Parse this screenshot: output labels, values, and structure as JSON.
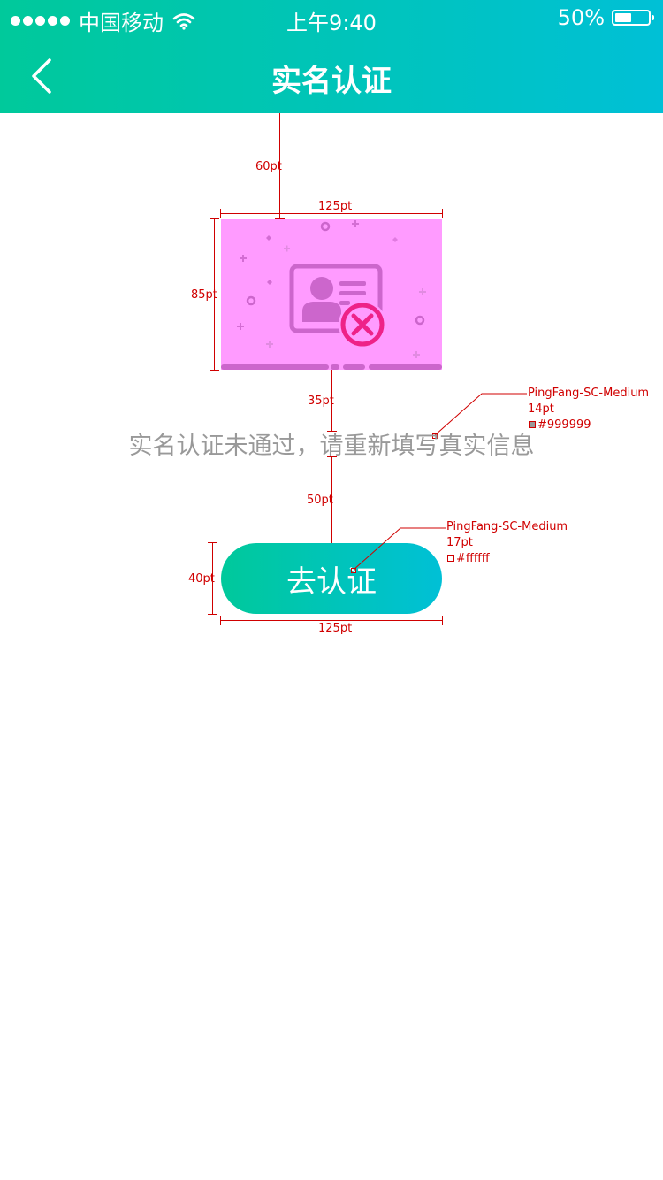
{
  "status_bar": {
    "carrier": "中国移动",
    "time": "上午9:40",
    "battery_text": "50%",
    "battery_level": 0.5
  },
  "nav": {
    "title": "实名认证",
    "back_icon": "chevron-left-icon"
  },
  "content": {
    "message": "实名认证未通过，请重新填写真实信息",
    "button_label": "去认证",
    "illustration_icon": "id-card-error-icon"
  },
  "annotations": {
    "top_spacing": "60pt",
    "image_width": "125pt",
    "image_height": "85pt",
    "image_to_text": "35pt",
    "text_font": "PingFang-SC-Medium",
    "text_size": "14pt",
    "text_color": "#999999",
    "text_to_button": "50pt",
    "button_font": "PingFang-SC-Medium",
    "button_size": "17pt",
    "button_color": "#ffffff",
    "button_height": "40pt",
    "button_width": "125pt"
  },
  "colors": {
    "gradient_start": "#00c99b",
    "gradient_end": "#00c0d6",
    "illustration_bg": "#ff9bff",
    "illustration_fg": "#cc66cc",
    "error_accent": "#ee2288",
    "message_text": "#999999",
    "annotation": "#d00000"
  }
}
